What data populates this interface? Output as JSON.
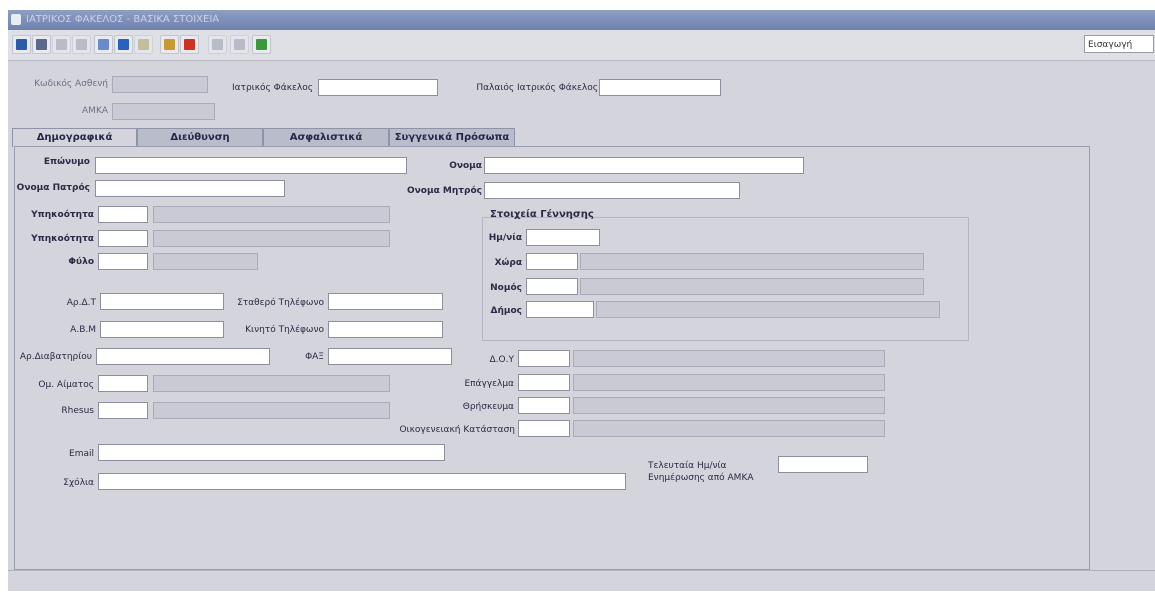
{
  "window": {
    "title": "ΙΑΤΡΙΚΟΣ ΦΑΚΕΛΟΣ - ΒΑΣΙΚΑ ΣΤΟΙΧΕΙΑ"
  },
  "toolbar": {
    "buttons": [
      {
        "name": "save-button",
        "icon": "floppy-icon",
        "color": "#2a5aa8"
      },
      {
        "name": "print-button",
        "icon": "printer-icon",
        "color": "#5a6a8a"
      },
      {
        "name": "clear-button",
        "icon": "clear-icon",
        "color": "#9aa0b0"
      },
      {
        "name": "delete-button",
        "icon": "delete-icon",
        "color": "#9aa0b0"
      },
      {
        "name": "new-record-button",
        "icon": "document-icon",
        "color": "#6a8ac8"
      },
      {
        "name": "help-button",
        "icon": "help-icon",
        "color": "#2a60c0"
      },
      {
        "name": "key-button",
        "icon": "key-icon",
        "color": "#b0a060"
      },
      {
        "name": "query-button",
        "icon": "query-icon",
        "color": "#c89a30"
      },
      {
        "name": "exit-button",
        "icon": "exit-icon",
        "color": "#d03020"
      },
      {
        "name": "grid-button",
        "icon": "grid-icon",
        "color": "#9aa0b0"
      },
      {
        "name": "list-button",
        "icon": "list-icon",
        "color": "#9aa0b0"
      },
      {
        "name": "image-button",
        "icon": "image-icon",
        "color": "#3a9a3a"
      }
    ],
    "mode": "Εισαγωγή"
  },
  "header": {
    "patient_code_label": "Κωδικός Ασθενή",
    "amka_label": "ΑΜΚΑ",
    "medical_file_label": "Ιατρικός Φάκελος",
    "old_medical_file_label": "Παλαιός Ιατρικός Φάκελος"
  },
  "tabs": [
    "Δημογραφικά",
    "Διεύθυνση",
    "Ασφαλιστικά",
    "Συγγενικά Πρόσωπα"
  ],
  "form": {
    "surname": "Επώνυμο",
    "name": "Ονομα",
    "father_name": "Ονομα Πατρός",
    "mother_name": "Ονομα Μητρός",
    "nationality": "Υπηκοότητα",
    "citizenship": "Υπηκοότητα",
    "gender": "Φύλο",
    "birth_group": "Στοιχεία Γέννησης",
    "birth_date": "Ημ/νία",
    "birth_country": "Χώρα",
    "birth_prefecture": "Νομός",
    "birth_municipality": "Δήμος",
    "id_number": "Αρ.Δ.Τ",
    "landline": "Σταθερό Τηλέφωνο",
    "abm": "Α.Β.Μ",
    "mobile": "Κινητό Τηλέφωνο",
    "passport": "Αρ.Διαβατηρίου",
    "vat": "ΦΑΞ",
    "tax_office": "Δ.Ο.Υ",
    "blood_group": "Ομ. Αίματος",
    "profession": "Επάγγελμα",
    "religion": "Θρήσκευμα",
    "rhesus": "Rhesus",
    "marital_status": "Οικογενειακή Κατάσταση",
    "email": "Email",
    "notes": "Σχόλια",
    "last_update_date": "Τελευταία Ημ/νία",
    "amka_update": "Ενημέρωσης από ΑΜΚΑ"
  }
}
